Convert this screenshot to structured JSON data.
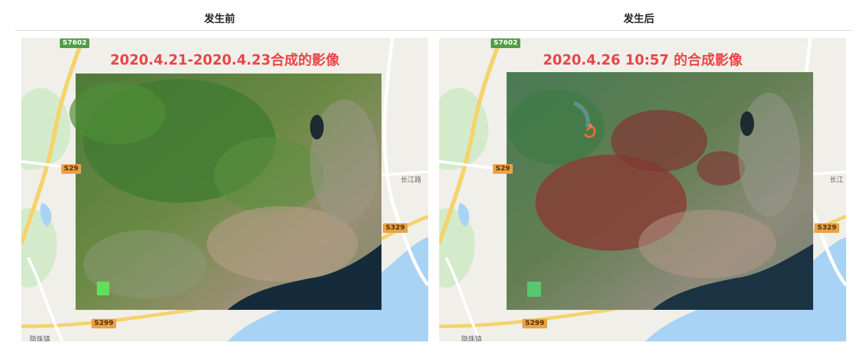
{
  "headers": {
    "before": "发生前",
    "after": "发生后"
  },
  "panels": {
    "before": {
      "title": "2020.4.21-2020.4.23合成的影像",
      "roads": {
        "s7602": "S7602",
        "s29": "S29",
        "s329": "S329",
        "s299": "S299"
      },
      "labels": {
        "changjiang": "长江路",
        "yinzhu": "隐珠镇"
      }
    },
    "after": {
      "title": "2020.4.26 10:57 的合成影像",
      "roads": {
        "s7602": "S7602",
        "s29": "S29",
        "s329": "S329",
        "s299": "S299"
      },
      "labels": {
        "changjiang": "长江",
        "yinzhu": "隐珠镇"
      }
    }
  },
  "colors": {
    "title_red": "#e84646",
    "sea": "#a9d3f5",
    "land": "#f1efe9",
    "green_area": "#cfe9c8",
    "road_yellow": "#f6d26b",
    "road_white": "#ffffff",
    "burn_scar": "#8a3b35"
  }
}
